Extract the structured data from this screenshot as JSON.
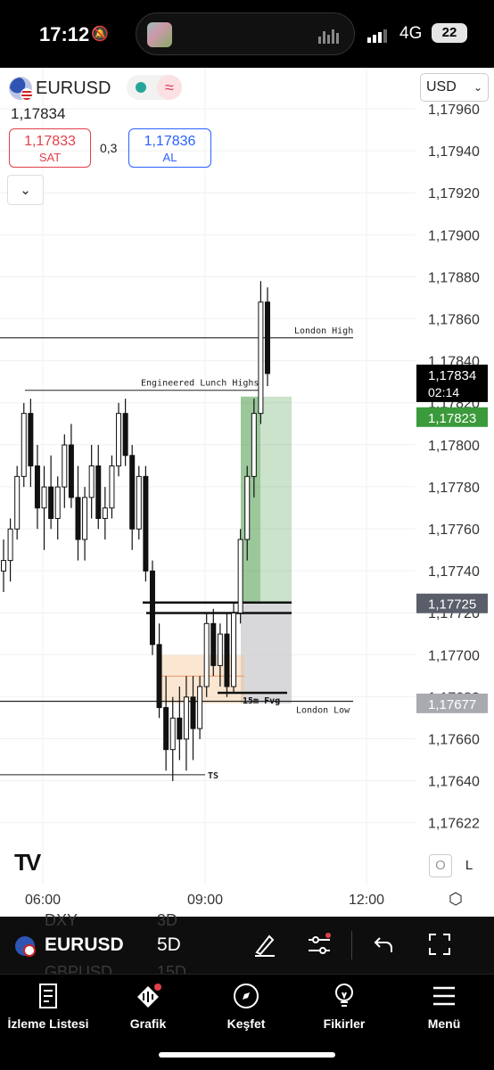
{
  "status": {
    "time": "17:12",
    "network": "4G",
    "battery": "22"
  },
  "header": {
    "symbol": "EURUSD",
    "last_price": "1,17834",
    "sell": {
      "price": "1,17833",
      "label": "SAT"
    },
    "buy": {
      "price": "1,17836",
      "label": "AL"
    },
    "spread": "0,3",
    "currency": "USD"
  },
  "chart_data": {
    "type": "candlestick",
    "price_axis": [
      "1,17960",
      "1,17940",
      "1,17920",
      "1,17900",
      "1,17880",
      "1,17860",
      "1,17840",
      "1,17820",
      "1,17800",
      "1,17780",
      "1,17760",
      "1,17740",
      "1,17720",
      "1,17700",
      "1,17680",
      "1,17660",
      "1,17640",
      "1,17622"
    ],
    "time_axis": [
      "06:00",
      "09:00",
      "12:00"
    ],
    "price_labels": {
      "current": "1,17834",
      "countdown": "02:14",
      "take_profit": "1,17823",
      "entry": "1,17725",
      "stop": "1,17677"
    },
    "annotations": {
      "london_high": "London High",
      "lunch_highs": "Engineered Lunch Highs",
      "fvg": "15m Fvg",
      "london_low": "London Low",
      "ts": "TS"
    },
    "levels": {
      "london_high": 1.17851,
      "lunch_highs": 1.17826,
      "london_low": 1.17678,
      "ts": 1.17643
    },
    "candles": [
      [
        1.1774,
        1.17755,
        1.1773,
        1.17745
      ],
      [
        1.17745,
        1.17765,
        1.17735,
        1.1776
      ],
      [
        1.1776,
        1.1779,
        1.17755,
        1.17785
      ],
      [
        1.17785,
        1.1782,
        1.1778,
        1.17815
      ],
      [
        1.17815,
        1.17822,
        1.1778,
        1.1779
      ],
      [
        1.1779,
        1.178,
        1.1776,
        1.1777
      ],
      [
        1.1777,
        1.1779,
        1.1775,
        1.1778
      ],
      [
        1.1778,
        1.17795,
        1.1776,
        1.17765
      ],
      [
        1.17765,
        1.17785,
        1.17755,
        1.1778
      ],
      [
        1.1778,
        1.17805,
        1.1777,
        1.178
      ],
      [
        1.178,
        1.1781,
        1.1777,
        1.17775
      ],
      [
        1.17775,
        1.1779,
        1.17745,
        1.17755
      ],
      [
        1.17755,
        1.1778,
        1.17745,
        1.17775
      ],
      [
        1.17775,
        1.178,
        1.17765,
        1.1779
      ],
      [
        1.1779,
        1.178,
        1.1776,
        1.17765
      ],
      [
        1.17765,
        1.1778,
        1.17755,
        1.1777
      ],
      [
        1.1777,
        1.17795,
        1.17765,
        1.1779
      ],
      [
        1.1779,
        1.1782,
        1.17785,
        1.17815
      ],
      [
        1.17815,
        1.17822,
        1.1779,
        1.17795
      ],
      [
        1.17795,
        1.178,
        1.1775,
        1.1776
      ],
      [
        1.1776,
        1.1779,
        1.17755,
        1.17785
      ],
      [
        1.17785,
        1.1779,
        1.17735,
        1.1774
      ],
      [
        1.1774,
        1.17745,
        1.177,
        1.17705
      ],
      [
        1.17705,
        1.17715,
        1.1767,
        1.17675
      ],
      [
        1.17675,
        1.1769,
        1.17645,
        1.17655
      ],
      [
        1.17655,
        1.1768,
        1.1764,
        1.1767
      ],
      [
        1.1767,
        1.17685,
        1.1765,
        1.1766
      ],
      [
        1.1766,
        1.1769,
        1.17645,
        1.1768
      ],
      [
        1.1768,
        1.1769,
        1.1765,
        1.17665
      ],
      [
        1.17665,
        1.1769,
        1.1766,
        1.17685
      ],
      [
        1.17685,
        1.1772,
        1.1768,
        1.17715
      ],
      [
        1.17715,
        1.17722,
        1.1769,
        1.17695
      ],
      [
        1.17695,
        1.17715,
        1.17685,
        1.1771
      ],
      [
        1.1771,
        1.1772,
        1.1768,
        1.17685
      ],
      [
        1.17685,
        1.17725,
        1.17682,
        1.1772
      ],
      [
        1.1772,
        1.1776,
        1.17715,
        1.17755
      ],
      [
        1.17755,
        1.1779,
        1.17745,
        1.17785
      ],
      [
        1.17785,
        1.17822,
        1.17775,
        1.17815
      ],
      [
        1.17815,
        1.17878,
        1.1781,
        1.17868
      ],
      [
        1.17868,
        1.17875,
        1.17828,
        1.17834
      ]
    ]
  },
  "toolbar": {
    "symbol": "EURUSD",
    "timeframe": "5D",
    "ghost1": "DXY",
    "ghost2": "3D",
    "ghost3": "GBPUSD",
    "ghost4": "15D"
  },
  "nav": {
    "watchlist": "İzleme Listesi",
    "chart": "Grafik",
    "explore": "Keşfet",
    "ideas": "Fikirler",
    "menu": "Menü"
  }
}
